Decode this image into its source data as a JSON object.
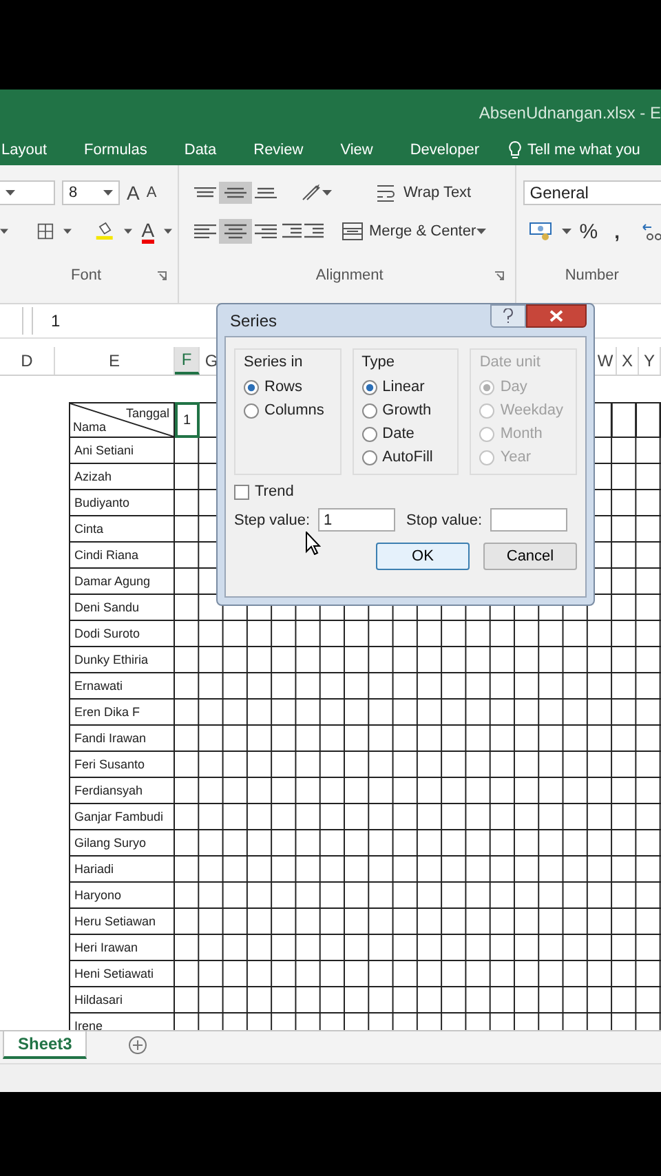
{
  "window": {
    "title": "AbsenUdnangan.xlsx - E"
  },
  "ribbon_tabs": [
    {
      "label": "Layout"
    },
    {
      "label": "Formulas"
    },
    {
      "label": "Data"
    },
    {
      "label": "Review"
    },
    {
      "label": "View"
    },
    {
      "label": "Developer"
    }
  ],
  "tell_me": "Tell me what you",
  "ribbon": {
    "font": {
      "label": "Font",
      "font_size": "8",
      "grow": "A",
      "shrink": "A",
      "font_color": "A"
    },
    "alignment": {
      "label": "Alignment",
      "vertical_align": [
        {
          "selected": false
        },
        {
          "selected": true
        },
        {
          "selected": false
        }
      ],
      "horizontal_align": [
        {
          "selected": false
        },
        {
          "selected": true
        },
        {
          "selected": false
        }
      ],
      "wrap_text": "Wrap Text",
      "merge_center": "Merge & Center"
    },
    "number": {
      "label": "Number",
      "format": "General",
      "percent": "%",
      "comma": ","
    }
  },
  "formula_bar": {
    "value": "1"
  },
  "column_headers": {
    "left": [
      "D",
      "E",
      "F",
      "G"
    ],
    "right": [
      "W",
      "X",
      "Y"
    ]
  },
  "table": {
    "corner_top": "Tanggal",
    "corner_bottom": "Nama",
    "first_day": {
      "value": "1",
      "selected": true
    },
    "names": [
      "Ani Setiani",
      "Azizah",
      "Budiyanto",
      "Cinta",
      "Cindi Riana",
      "Damar Agung",
      "Deni Sandu",
      "Dodi Suroto",
      "Dunky Ethiria",
      "Ernawati",
      "Eren Dika F",
      "Fandi Irawan",
      "Feri Susanto",
      "Ferdiansyah",
      "Ganjar Fambudi",
      "Gilang Suryo",
      "Hariadi",
      "Haryono",
      "Heru Setiawan",
      "Heri Irawan",
      "Heni Setiawati",
      "Hildasari",
      "Irene"
    ]
  },
  "sheet_tabs": [
    {
      "label": "Sheet3",
      "selected": true
    }
  ],
  "dialog": {
    "title": "Series",
    "groups": [
      {
        "title": "Series in",
        "disabled": false,
        "options": [
          {
            "label": "Rows",
            "selected": true
          },
          {
            "label": "Columns",
            "selected": false
          }
        ]
      },
      {
        "title": "Type",
        "disabled": false,
        "options": [
          {
            "label": "Linear",
            "selected": true
          },
          {
            "label": "Growth",
            "selected": false
          },
          {
            "label": "Date",
            "selected": false
          },
          {
            "label": "AutoFill",
            "selected": false
          }
        ]
      },
      {
        "title": "Date unit",
        "disabled": true,
        "options": [
          {
            "label": "Day",
            "selected": true
          },
          {
            "label": "Weekday",
            "selected": false
          },
          {
            "label": "Month",
            "selected": false
          },
          {
            "label": "Year",
            "selected": false
          }
        ]
      }
    ],
    "trend": {
      "label": "Trend",
      "checked": false
    },
    "step_value": {
      "label": "Step value:",
      "value": "1"
    },
    "stop_value": {
      "label": "Stop value:"
    },
    "buttons": [
      {
        "label": "OK",
        "default": true
      },
      {
        "label": "Cancel",
        "default": false
      }
    ]
  }
}
